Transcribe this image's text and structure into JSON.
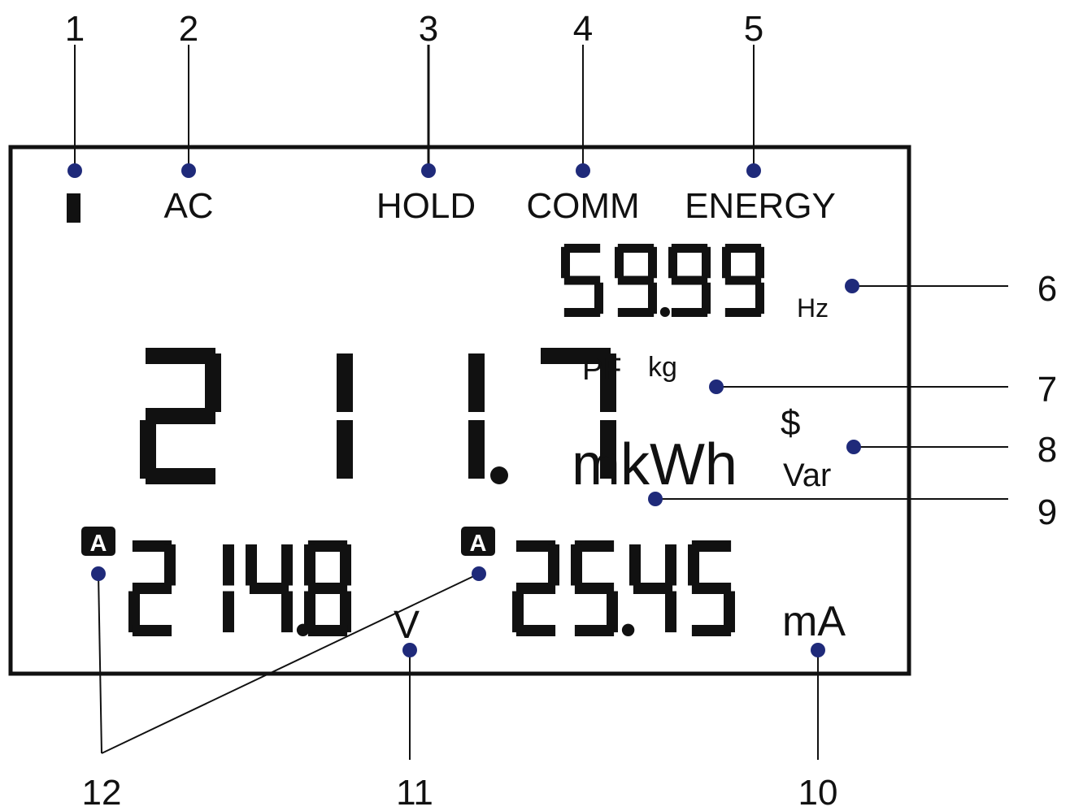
{
  "callouts": {
    "n1": "1",
    "n2": "2",
    "n3": "3",
    "n4": "4",
    "n5": "5",
    "n6": "6",
    "n7": "7",
    "n8": "8",
    "n9": "9",
    "n10": "10",
    "n11": "11",
    "n12": "12"
  },
  "lcd": {
    "annunciators": {
      "ac": "AC",
      "hold": "HOLD",
      "comm": "COMM",
      "energy": "ENERGY"
    },
    "frequency": {
      "value": "59.99",
      "unit": "Hz"
    },
    "main": {
      "value": "211.7",
      "pf": "PF",
      "kg": "kg",
      "dollar": "$",
      "unit": "mkWh",
      "var": "Var"
    },
    "voltage": {
      "badge": "A",
      "value": "214.8",
      "unit": "V"
    },
    "current": {
      "badge": "A",
      "value": "25.45",
      "unit": "mA"
    }
  },
  "colors": {
    "dot": "#1f2a7a",
    "segment": "#111111",
    "frame": "#111111"
  }
}
